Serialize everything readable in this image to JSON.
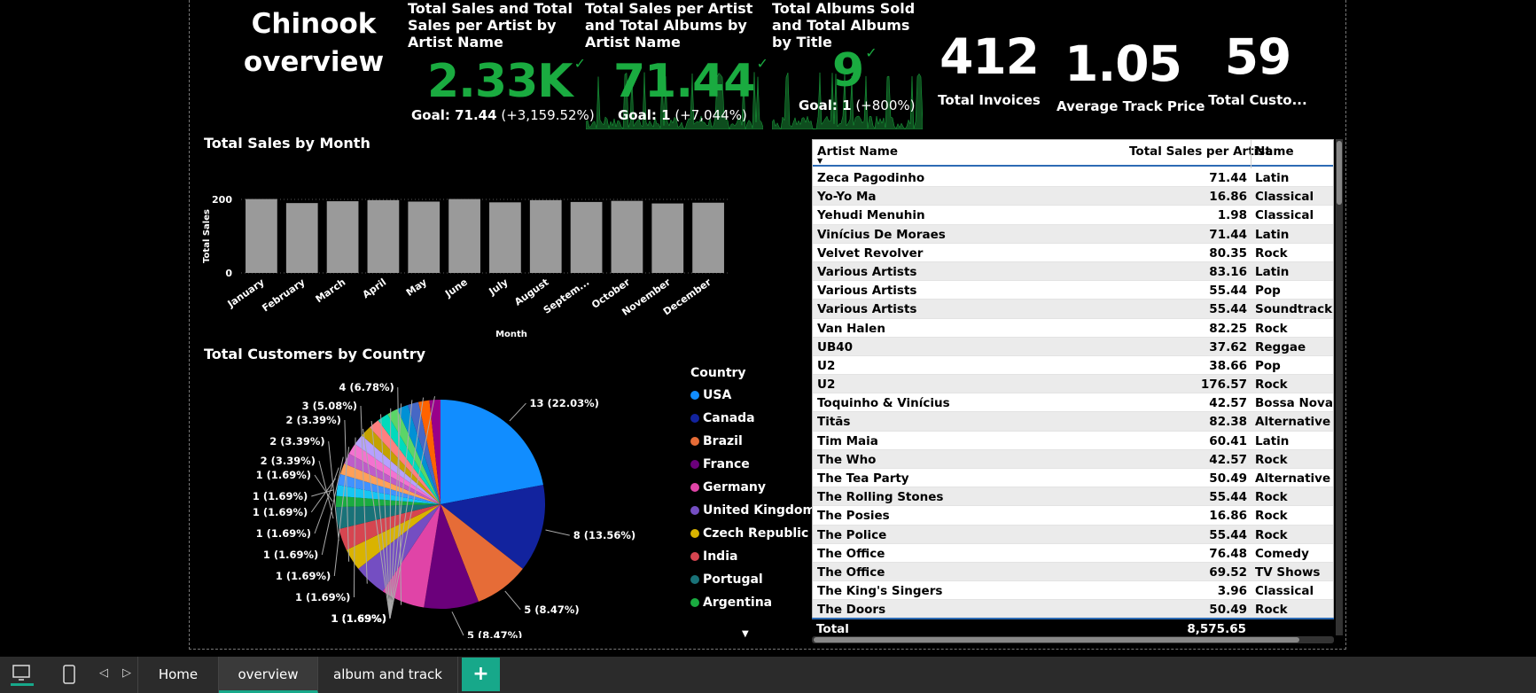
{
  "report": {
    "title_line1": "Chinook",
    "title_line2": "overview"
  },
  "kpis": [
    {
      "title": "Total Sales and Total Sales per Artist by Artist Name",
      "value": "2.33K",
      "goal_label": "Goal: 71.44",
      "goal_delta": "(+3,159.52%)"
    },
    {
      "title": "Total Sales per Artist and Total Albums by Artist Name",
      "value": "71.44",
      "goal_label": "Goal: 1",
      "goal_delta": "(+7,044%)"
    },
    {
      "title": "Total Albums Sold and Total Albums by Title",
      "value": "9",
      "goal_label": "Goal: 1",
      "goal_delta": "(+800%)"
    }
  ],
  "cards": [
    {
      "value": "412",
      "label": "Total Invoices"
    },
    {
      "value": "1.05",
      "label": "Average Track Price"
    },
    {
      "value": "59",
      "label": "Total Custo..."
    }
  ],
  "colors": {
    "kpi_green": "#1aab40",
    "bar_gray": "#9a9a9a",
    "tab_accent": "#17a88a",
    "table_header_line": "#2d6bb5"
  },
  "chart_data": [
    {
      "type": "bar",
      "title": "Total Sales by Month",
      "xlabel": "Month",
      "ylabel": "Total Sales",
      "ylim": [
        0,
        200
      ],
      "yticks": [
        "200",
        "0"
      ],
      "categories": [
        "January",
        "February",
        "March",
        "April",
        "May",
        "June",
        "July",
        "August",
        "Septem...",
        "October",
        "November",
        "December"
      ],
      "values": [
        201,
        190,
        195,
        198,
        194,
        201,
        192,
        198,
        193,
        196,
        189,
        191
      ]
    },
    {
      "type": "pie",
      "title": "Total Customers by Country",
      "legend_title": "Country",
      "legend_position": "right",
      "slices": [
        {
          "name": "USA",
          "value": 13,
          "label": "13 (22.03%)",
          "color": "#118dff"
        },
        {
          "name": "Canada",
          "value": 8,
          "label": "8 (13.56%)",
          "color": "#12239e"
        },
        {
          "name": "Brazil",
          "value": 5,
          "label": "5 (8.47%)",
          "color": "#e66c37"
        },
        {
          "name": "France",
          "value": 5,
          "label": "5 (8.47%)",
          "color": "#6b007b"
        },
        {
          "name": "Germany",
          "value": 4,
          "label": "4 (6.78%)",
          "color": "#e044a7"
        },
        {
          "name": "United Kingdom",
          "value": 3,
          "label": "3 (5.08%)",
          "color": "#744ec2"
        },
        {
          "name": "Czech Republic",
          "value": 2,
          "label": "2 (3.39%)",
          "color": "#d9b300"
        },
        {
          "name": "India",
          "value": 2,
          "label": "2 (3.39%)",
          "color": "#d64550"
        },
        {
          "name": "Portugal",
          "value": 2,
          "label": "2 (3.39%)",
          "color": "#197278"
        },
        {
          "name": "Argentina",
          "value": 1,
          "label": "1 (1.69%)",
          "color": "#1aab40"
        },
        {
          "name": "",
          "value": 1,
          "label": "1 (1.69%)",
          "color": "#15c6f4"
        },
        {
          "name": "",
          "value": 1,
          "label": "1 (1.69%)",
          "color": "#4092ff"
        },
        {
          "name": "",
          "value": 1,
          "label": "1 (1.69%)",
          "color": "#ffa058"
        },
        {
          "name": "",
          "value": 1,
          "label": "1 (1.69%)",
          "color": "#be5dc9"
        },
        {
          "name": "",
          "value": 1,
          "label": "1 (1.69%)",
          "color": "#f472d0"
        },
        {
          "name": "",
          "value": 1,
          "label": "1 (1.69%)",
          "color": "#b5a1ff"
        },
        {
          "name": "",
          "value": 1,
          "label": "1 (1.69%)",
          "color": "#c4a200"
        },
        {
          "name": "",
          "value": 1,
          "label": "1 (1.69%)",
          "color": "#ff8080"
        },
        {
          "name": "",
          "value": 1,
          "label": "1 (1.69%)",
          "color": "#00dbbc"
        },
        {
          "name": "",
          "value": 1,
          "label": "1 (1.69%)",
          "color": "#5bd667"
        },
        {
          "name": "",
          "value": 1,
          "label": "1 (1.69%)",
          "color": "#0091d5"
        },
        {
          "name": "",
          "value": 1,
          "label": "1 (1.69%)",
          "color": "#4668c5"
        },
        {
          "name": "",
          "value": 1,
          "label": "1 (1.69%)",
          "color": "#ff6300"
        },
        {
          "name": "",
          "value": 1,
          "label": "1 (1.69%)",
          "color": "#99008a"
        }
      ]
    },
    {
      "type": "table",
      "columns": [
        "Artist Name",
        "Total Sales per Artist",
        "Name"
      ],
      "rows": [
        [
          "Zeca Pagodinho",
          "71.44",
          "Latin"
        ],
        [
          "Yo-Yo Ma",
          "16.86",
          "Classical"
        ],
        [
          "Yehudi Menuhin",
          "1.98",
          "Classical"
        ],
        [
          "Vinícius De Moraes",
          "71.44",
          "Latin"
        ],
        [
          "Velvet Revolver",
          "80.35",
          "Rock"
        ],
        [
          "Various Artists",
          "83.16",
          "Latin"
        ],
        [
          "Various Artists",
          "55.44",
          "Pop"
        ],
        [
          "Various Artists",
          "55.44",
          "Soundtrack"
        ],
        [
          "Van Halen",
          "82.25",
          "Rock"
        ],
        [
          "UB40",
          "37.62",
          "Reggae"
        ],
        [
          "U2",
          "38.66",
          "Pop"
        ],
        [
          "U2",
          "176.57",
          "Rock"
        ],
        [
          "Toquinho & Vinícius",
          "42.57",
          "Bossa Nova"
        ],
        [
          "Titãs",
          "82.38",
          "Alternative &"
        ],
        [
          "Tim Maia",
          "60.41",
          "Latin"
        ],
        [
          "The Who",
          "42.57",
          "Rock"
        ],
        [
          "The Tea Party",
          "50.49",
          "Alternative &"
        ],
        [
          "The Rolling Stones",
          "55.44",
          "Rock"
        ],
        [
          "The Posies",
          "16.86",
          "Rock"
        ],
        [
          "The Police",
          "55.44",
          "Rock"
        ],
        [
          "The Office",
          "76.48",
          "Comedy"
        ],
        [
          "The Office",
          "69.52",
          "TV Shows"
        ],
        [
          "The King's Singers",
          "3.96",
          "Classical"
        ],
        [
          "The Doors",
          "50.49",
          "Rock"
        ]
      ],
      "total_label": "Total",
      "total_value": "8,575.65"
    }
  ],
  "taskbar": {
    "tabs": [
      "Home",
      "overview",
      "album and track"
    ],
    "active_tab": "overview",
    "add_label": "+"
  }
}
